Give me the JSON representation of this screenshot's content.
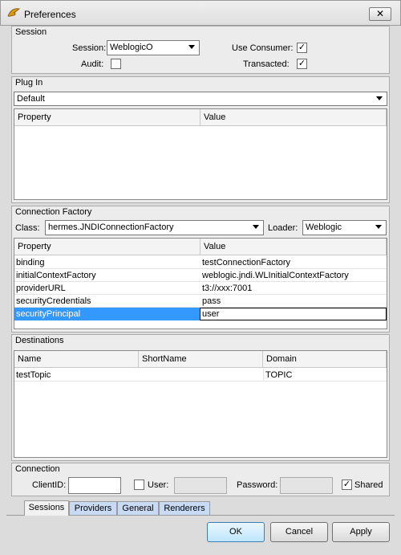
{
  "window": {
    "title": "Preferences",
    "close_glyph": "✕",
    "icon": "hermes-wing-icon"
  },
  "session": {
    "section_title": "Session",
    "session_label": "Session:",
    "session_value": "WeblogicO",
    "use_consumer_label": "Use Consumer:",
    "use_consumer_checked": true,
    "audit_label": "Audit:",
    "audit_checked": false,
    "transacted_label": "Transacted:",
    "transacted_checked": true,
    "check_glyph": "✓"
  },
  "plugin": {
    "section_title": "Plug In",
    "selected": "Default",
    "columns": [
      "Property",
      "Value"
    ]
  },
  "connection_factory": {
    "section_title": "Connection Factory",
    "class_label": "Class:",
    "class_value": "hermes.JNDIConnectionFactory",
    "loader_label": "Loader:",
    "loader_value": "Weblogic",
    "columns": [
      "Property",
      "Value"
    ],
    "rows": [
      {
        "property": "binding",
        "value": "testConnectionFactory"
      },
      {
        "property": "initialContextFactory",
        "value": "weblogic.jndi.WLInitialContextFactory"
      },
      {
        "property": "providerURL",
        "value": "t3://xxx:7001"
      },
      {
        "property": "securityCredentials",
        "value": "pass"
      },
      {
        "property": "securityPrincipal",
        "value": "user"
      }
    ]
  },
  "destinations": {
    "section_title": "Destinations",
    "columns": [
      "Name",
      "ShortName",
      "Domain"
    ],
    "rows": [
      {
        "name": "testTopic",
        "short_name": "",
        "domain": "TOPIC"
      }
    ]
  },
  "connection": {
    "section_title": "Connection",
    "client_id_label": "ClientID:",
    "client_id_value": "",
    "user_label": "User:",
    "user_checked": false,
    "password_label": "Password:",
    "shared_label": "Shared",
    "shared_checked": true
  },
  "tabs": [
    "Sessions",
    "Providers",
    "General",
    "Renderers"
  ],
  "active_tab": "Sessions",
  "buttons": {
    "ok": "OK",
    "cancel": "Cancel",
    "apply": "Apply"
  }
}
